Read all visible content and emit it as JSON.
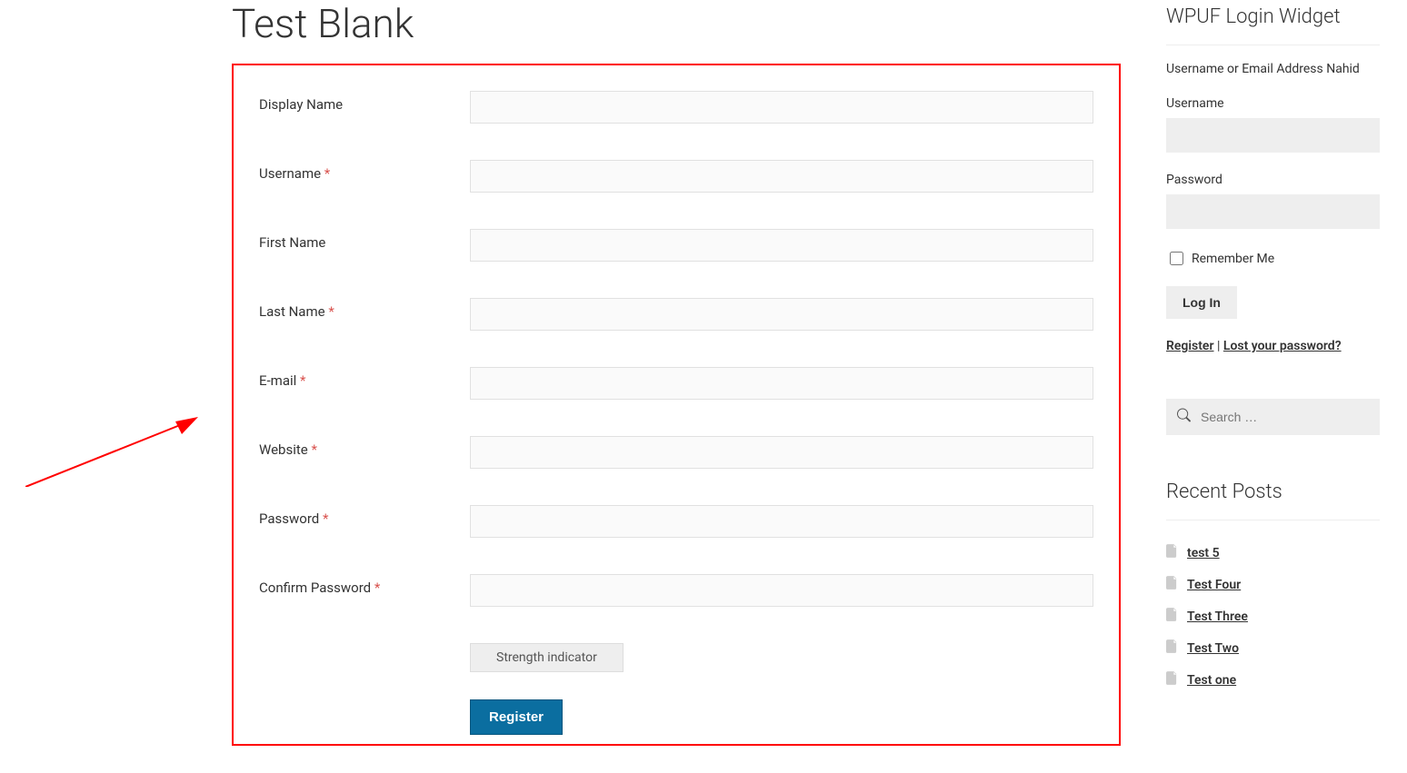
{
  "page": {
    "title": "Test Blank"
  },
  "form": {
    "fields": {
      "display_name": {
        "label": "Display Name",
        "required": false
      },
      "username": {
        "label": "Username",
        "required": true
      },
      "first_name": {
        "label": "First Name",
        "required": false
      },
      "last_name": {
        "label": "Last Name",
        "required": true
      },
      "email": {
        "label": "E-mail",
        "required": true
      },
      "website": {
        "label": "Website",
        "required": true
      },
      "password": {
        "label": "Password",
        "required": true
      },
      "confirm_pw": {
        "label": "Confirm Password",
        "required": true
      }
    },
    "asterisk": "*",
    "strength_label": "Strength indicator",
    "submit_label": "Register"
  },
  "login_widget": {
    "title": "WPUF Login Widget",
    "note": "Username or Email Address Nahid",
    "username_label": "Username",
    "password_label": "Password",
    "remember_label": "Remember Me",
    "login_btn": "Log In",
    "register_link": "Register",
    "sep": " | ",
    "lost_pw_link": "Lost your password?"
  },
  "search": {
    "placeholder": "Search …"
  },
  "recent": {
    "title": "Recent Posts",
    "items": [
      "test 5",
      "Test Four",
      "Test Three",
      "Test Two",
      "Test one"
    ]
  }
}
